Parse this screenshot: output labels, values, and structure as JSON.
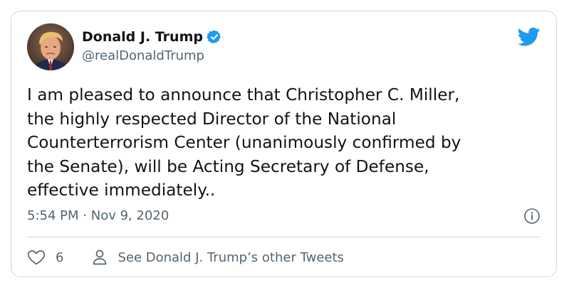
{
  "author": {
    "display_name": "Donald J. Trump",
    "handle": "@realDonaldTrump",
    "verified": true
  },
  "tweet": {
    "lines": [
      "I am pleased to announce that Christopher C. Miller,",
      "the highly respected Director of the National",
      "Counterterrorism Center (unanimously confirmed by",
      "the Senate), will be Acting Secretary of Defense,",
      "effective immediately.."
    ],
    "time": "5:54 PM",
    "separator": "·",
    "date": "Nov 9, 2020"
  },
  "footer": {
    "like_count": "6",
    "see_other_tweets": "See Donald J. Trump’s other Tweets"
  },
  "icons": {
    "verified": "verified-badge-icon",
    "brand": "twitter-bird-icon",
    "info": "info-icon",
    "like": "heart-icon",
    "profile": "user-icon"
  },
  "colors": {
    "brand": "#1d9bf0",
    "text_primary": "#0f1419",
    "text_secondary": "#536471",
    "border": "#cfd9de"
  }
}
